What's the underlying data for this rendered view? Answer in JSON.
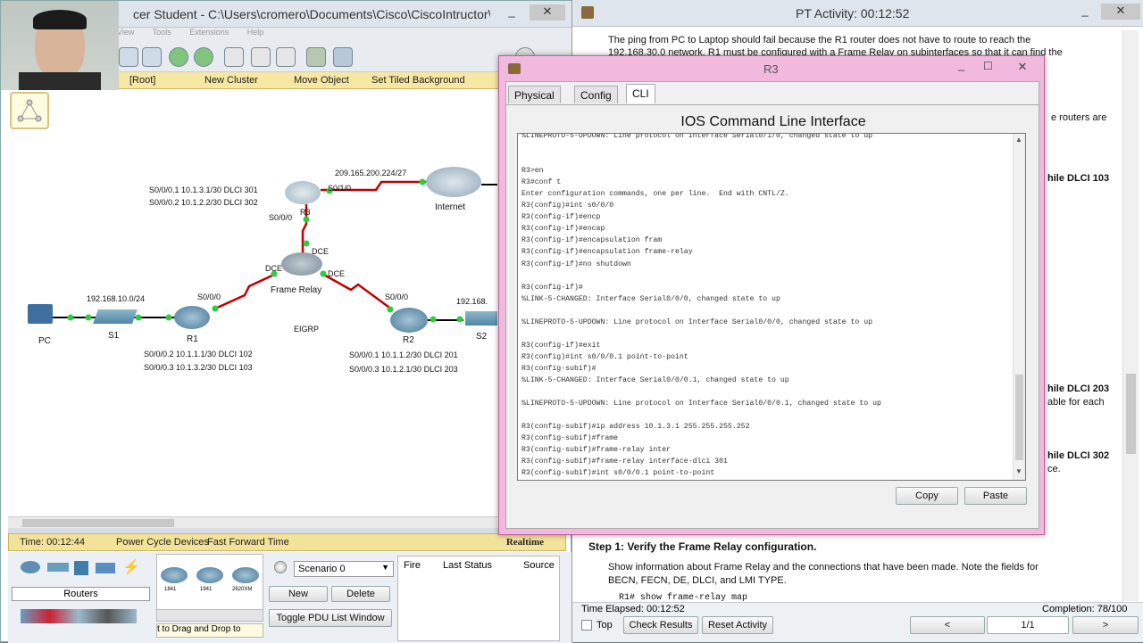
{
  "left_window": {
    "title": "cer Student - C:\\Users\\cromero\\Documents\\Cisco\\CiscoIntructor\\...",
    "menu": [
      "View",
      "Tools",
      "Extensions",
      "Help"
    ],
    "logical_bar": {
      "root": "[Root]",
      "new_cluster": "New Cluster",
      "move_object": "Move Object",
      "tiled_bg": "Set Tiled Background"
    },
    "topology": {
      "r3_sub1": "S0/0/0.1 10.1.3.1/30 DLCI 301",
      "r3_sub2": "S0/0/0.2 10.1.2.2/30 DLCI 302",
      "r3_s010": "S0/1/0",
      "internet_net": "209.165.200.224/27",
      "internet": "Internet",
      "r3_s000": "S0/0/0",
      "r3_name": "R3",
      "dce_top": "DCE",
      "dce_left": "DCE",
      "dce_right": "DCE",
      "frame_relay": "Frame Relay",
      "lan_net": "192.168.10.0/24",
      "r1_s000": "S0/0/0",
      "r2_s000": "S0/0/0",
      "s2_net": "192.168.",
      "pc": "PC",
      "s1": "S1",
      "r1": "R1",
      "eigrp": "EIGRP",
      "r2": "R2",
      "s2": "S2",
      "r1_sub2": "S0/0/0.2 10.1.1.1/30 DLCI 102",
      "r1_sub3": "S0/0/0.3 10.1.3.2/30 DLCI 103",
      "r2_sub1": "S0/0/0.1 10.1.1.2/30 DLCI 201",
      "r2_sub3": "S0/0/0.3 10.1.2.1/30 DLCI 203"
    },
    "status": {
      "time": "Time: 00:12:44",
      "power": "Power Cycle Devices",
      "fast_forward": "Fast Forward Time",
      "realtime": "Realtime"
    },
    "bottom": {
      "category": "Routers",
      "models": [
        "1841",
        "1941",
        "2620XM"
      ],
      "scenario": "Scenario 0",
      "new": "New",
      "delete": "Delete",
      "toggle": "Toggle PDU List Window",
      "cols": [
        "Fire",
        "Last Status",
        "Source"
      ],
      "hint": "t to Drag and Drop to"
    }
  },
  "right_window": {
    "title": "PT Activity: 00:12:52",
    "para1a": "The ping from PC to Laptop should fail because the R1 router does not have to route to reach the",
    "para1b": "192.168.30.0 network. R1 must be configured with a Frame Relay on subinterfaces so that it can find the",
    "frag_routers": "e routers are",
    "frag_103": "hile DLCI 103",
    "frag_203": "hile DLCI 203",
    "frag_each": "able for each",
    "frag_302": "hile DLCI 302",
    "frag_ce": "ce.",
    "step": "Step 1:  Verify the Frame Relay configuration.",
    "step_desc1": "Show information about Frame Relay and the connections that have been made. Note the fields for",
    "step_desc2": "BECN, FECN, DE, DLCI, and LMI TYPE.",
    "step_cmd": "R1# show frame-relay map",
    "elapsed": "Time Elapsed: 00:12:52",
    "completion": "Completion: 78/100",
    "top": "Top",
    "check": "Check Results",
    "reset": "Reset Activity",
    "prev": "<",
    "page": "1/1",
    "next": ">"
  },
  "r3_dialog": {
    "title": "R3",
    "tabs": [
      "Physical",
      "Config",
      "CLI"
    ],
    "heading": "IOS Command Line Interface",
    "lines": [
      "%LINEPROTO-5-UPDOWN: Line protocol on Interface Serial0/1/0, changed state to up",
      "",
      "",
      "R3>en",
      "R3#conf t",
      "Enter configuration commands, one per line.  End with CNTL/Z.",
      "R3(config)#int s0/0/0",
      "R3(config-if)#encp",
      "R3(config-if)#encap",
      "R3(config-if)#encapsulation fram",
      "R3(config-if)#encapsulation frame-relay",
      "R3(config-if)#no shutdown",
      "",
      "R3(config-if)#",
      "%LINK-5-CHANGED: Interface Serial0/0/0, changed state to up",
      "",
      "%LINEPROTO-5-UPDOWN: Line protocol on Interface Serial0/0/0, changed state to up",
      "",
      "R3(config-if)#exit",
      "R3(config)#int s0/0/0.1 point-to-point",
      "R3(config-subif)#",
      "%LINK-5-CHANGED: Interface Serial0/0/0.1, changed state to up",
      "",
      "%LINEPROTO-5-UPDOWN: Line protocol on Interface Serial0/0/0.1, changed state to up",
      "",
      "R3(config-subif)#ip address 10.1.3.1 255.255.255.252",
      "R3(config-subif)#frame",
      "R3(config-subif)#frame-relay inter",
      "R3(config-subif)#frame-relay interface-dlci 301",
      "R3(config-subif)#int s0/0/0.1 point-to-point"
    ],
    "copy": "Copy",
    "paste": "Paste"
  }
}
